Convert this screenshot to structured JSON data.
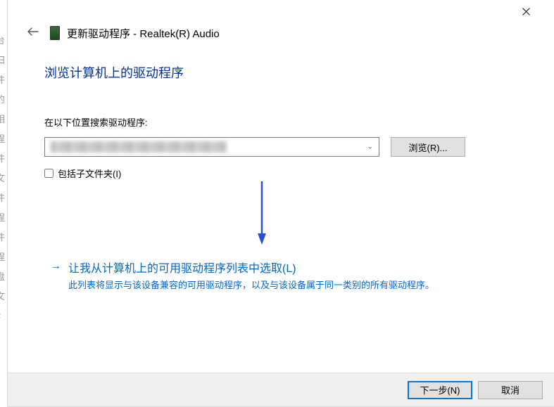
{
  "window": {
    "title_prefix": "更新驱动程序",
    "title_device": "Realtek(R) Audio",
    "full_title": "更新驱动程序 - Realtek(R) Audio"
  },
  "page": {
    "heading": "浏览计算机上的驱动程序",
    "search_label": "在以下位置搜索驱动程序:",
    "path_value": "",
    "browse_button": "浏览(R)...",
    "include_subfolders_label": "包括子文件夹(I)",
    "include_subfolders_checked": false
  },
  "option": {
    "title": "让我从计算机上的可用驱动程序列表中选取(L)",
    "description": "此列表将显示与该设备兼容的可用驱动程序，以及与该设备属于同一类别的所有驱动程序。"
  },
  "footer": {
    "next": "下一步(N)",
    "cancel": "取消"
  },
  "icons": {
    "close": "close-icon",
    "back": "back-arrow-icon",
    "device": "device-icon",
    "combo_caret": "chevron-down-icon",
    "option_arrow": "right-arrow-icon"
  },
  "colors": {
    "heading_blue": "#003399",
    "link_blue": "#0066cc",
    "button_face": "#e1e1e1",
    "button_border": "#adadad",
    "accent": "#0078d7"
  }
}
